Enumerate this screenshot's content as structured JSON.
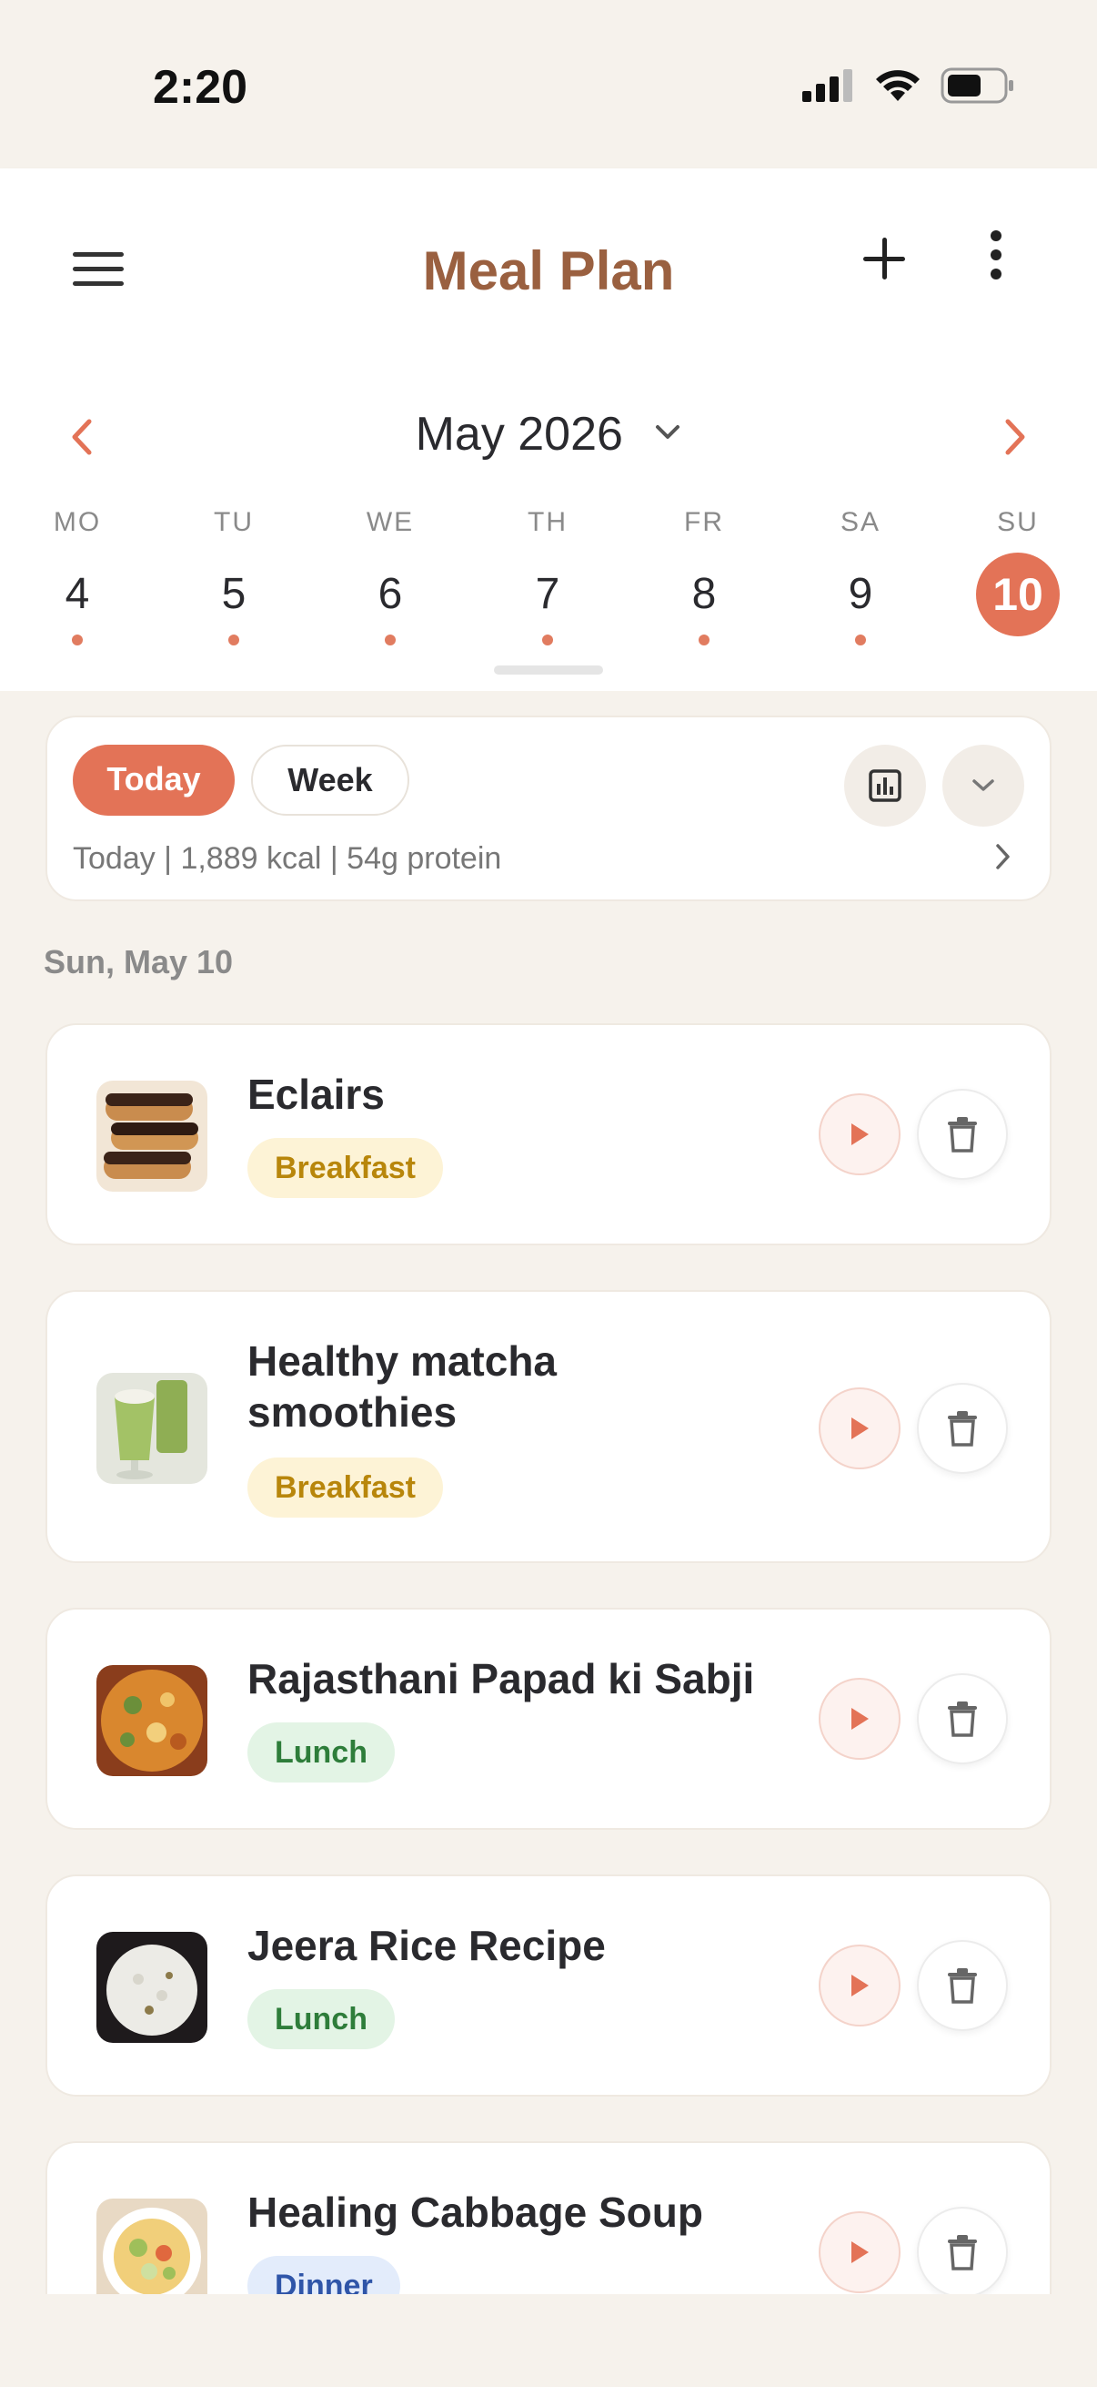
{
  "status_bar": {
    "time": "2:20"
  },
  "header": {
    "title": "Meal Plan"
  },
  "calendar": {
    "month": "May 2026",
    "days": [
      {
        "name": "MO",
        "num": "4",
        "has_meal": true,
        "selected": false
      },
      {
        "name": "TU",
        "num": "5",
        "has_meal": true,
        "selected": false
      },
      {
        "name": "WE",
        "num": "6",
        "has_meal": true,
        "selected": false
      },
      {
        "name": "TH",
        "num": "7",
        "has_meal": true,
        "selected": false
      },
      {
        "name": "FR",
        "num": "8",
        "has_meal": true,
        "selected": false
      },
      {
        "name": "SA",
        "num": "9",
        "has_meal": true,
        "selected": false
      },
      {
        "name": "SU",
        "num": "10",
        "has_meal": false,
        "selected": true
      }
    ]
  },
  "summary": {
    "today_label": "Today",
    "week_label": "Week",
    "text": "Today | 1,889 kcal | 54g protein"
  },
  "date_heading": "Sun, May 10",
  "meals": [
    {
      "name": "Eclairs",
      "tag": "Breakfast",
      "type": "breakfast"
    },
    {
      "name": "Healthy matcha smoothies",
      "tag": "Breakfast",
      "type": "breakfast"
    },
    {
      "name": "Rajasthani Papad ki Sabji",
      "tag": "Lunch",
      "type": "lunch"
    },
    {
      "name": "Jeera Rice Recipe",
      "tag": "Lunch",
      "type": "lunch"
    },
    {
      "name": "Healing Cabbage Soup",
      "tag": "Dinner",
      "type": "dinner"
    }
  ],
  "colors": {
    "accent": "#e37357",
    "title": "#9a6040",
    "background": "#f6f2ec"
  }
}
